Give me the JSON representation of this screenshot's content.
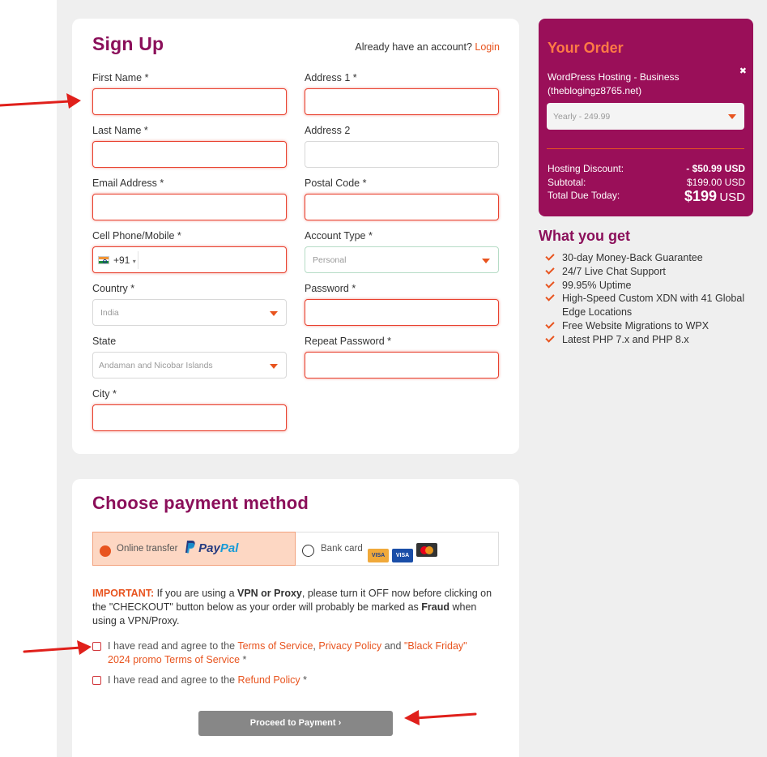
{
  "signup": {
    "title": "Sign Up",
    "already_text": "Already have an account?",
    "login_link": "Login",
    "fields": {
      "first_name": "First Name *",
      "last_name": "Last Name *",
      "email": "Email Address *",
      "phone": "Cell Phone/Mobile *",
      "country": "Country *",
      "state": "State",
      "city": "City *",
      "address1": "Address 1 *",
      "address2": "Address 2",
      "postal": "Postal Code *",
      "account_type": "Account Type *",
      "password": "Password *",
      "repeat_password": "Repeat Password *"
    },
    "values": {
      "dial_code": "+91",
      "dial_caret": "▾",
      "country": "India",
      "state": "Andaman and Nicobar Islands",
      "account_type": "Personal"
    }
  },
  "order": {
    "title": "Your Order",
    "product": "WordPress Hosting - Business",
    "domain": "(theblogingz8765.net)",
    "close": "✖",
    "plan": "Yearly - 249.99",
    "discount_label": "Hosting Discount:",
    "discount_value": "- $50.99 USD",
    "subtotal_label": "Subtotal:",
    "subtotal_value": "$199.00 USD",
    "total_label": "Total Due Today:",
    "total_amount": "$199",
    "total_currency": "USD"
  },
  "what_you_get": {
    "title": "What you get",
    "items": [
      "30-day Money-Back Guarantee",
      "24/7 Live Chat Support",
      "99.95% Uptime",
      "High-Speed Custom XDN with 41 Global Edge Locations",
      "Free Website Migrations to WPX",
      "Latest PHP 7.x and PHP 8.x"
    ]
  },
  "payment": {
    "title": "Choose payment method",
    "paypal_label": "Online transfer",
    "paypal_brand_1": "Pay",
    "paypal_brand_2": "Pal",
    "bank_label": "Bank card",
    "card_visa": "VISA",
    "card_mc": "MC",
    "important_label": "IMPORTANT:",
    "important_1": " If you are using a ",
    "important_vpn": "VPN or Proxy",
    "important_2": ", please turn it OFF now before clicking on the \"CHECKOUT\" button below as your order will probably be marked as ",
    "important_fraud": "Fraud",
    "important_3": " when using a VPN/Proxy.",
    "agree1_prefix": "I have read and agree to the ",
    "agree1_tos": "Terms of Service",
    "agree1_comma": ", ",
    "agree1_privacy": "Privacy Policy",
    "agree1_and": " and ",
    "agree1_promo": "\"Black Friday\" 2024 promo Terms of Service",
    "agree1_star": " *",
    "agree2_prefix": "I have read and agree to the ",
    "agree2_refund": "Refund Policy",
    "agree2_star": " *",
    "proceed": "Proceed to Payment  ›"
  },
  "colors": {
    "brand": "#8b0f5a",
    "accent": "#e8541f",
    "error": "#e8412f",
    "order_bg": "#9a0f59",
    "arrow": "#e0201b"
  }
}
